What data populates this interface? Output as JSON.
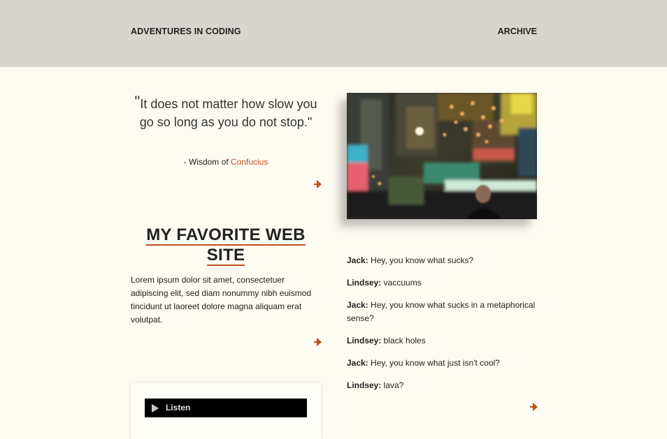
{
  "header": {
    "site_title": "ADVENTURES IN CODING",
    "nav_archive": "ARCHIVE"
  },
  "quote": {
    "open_mark": "\"",
    "text": "It does not matter how slow you go so long as you do not stop.\"",
    "attribution_prefix": "- Wisdom of ",
    "attribution_link": "Confucius"
  },
  "section": {
    "title": "MY FAVORITE WEB SITE",
    "body": "Lorem ipsum dolor sit amet, consectetuer adipiscing elit, sed diam nonummy nibh euismod tincidunt ut laoreet dolore magna aliquam erat volutpat."
  },
  "chat": [
    {
      "speaker": "Jack:",
      "line": " Hey, you know what sucks?"
    },
    {
      "speaker": "Lindsey:",
      "line": " vaccuums"
    },
    {
      "speaker": "Jack:",
      "line": " Hey, you know what sucks in a metaphorical sense?"
    },
    {
      "speaker": "Lindsey:",
      "line": " black holes"
    },
    {
      "speaker": "Jack:",
      "line": " Hey, you know what just isn't cool?"
    },
    {
      "speaker": "Lindsey:",
      "line": " lava?"
    }
  ],
  "player": {
    "label": "Listen"
  },
  "icons": {
    "more": "arrow-right-icon",
    "play": "play-icon"
  },
  "colors": {
    "accent": "#c0501e",
    "header_bg": "#d8d5cf",
    "page_bg": "#fefbf3",
    "player_bg": "#000000"
  }
}
